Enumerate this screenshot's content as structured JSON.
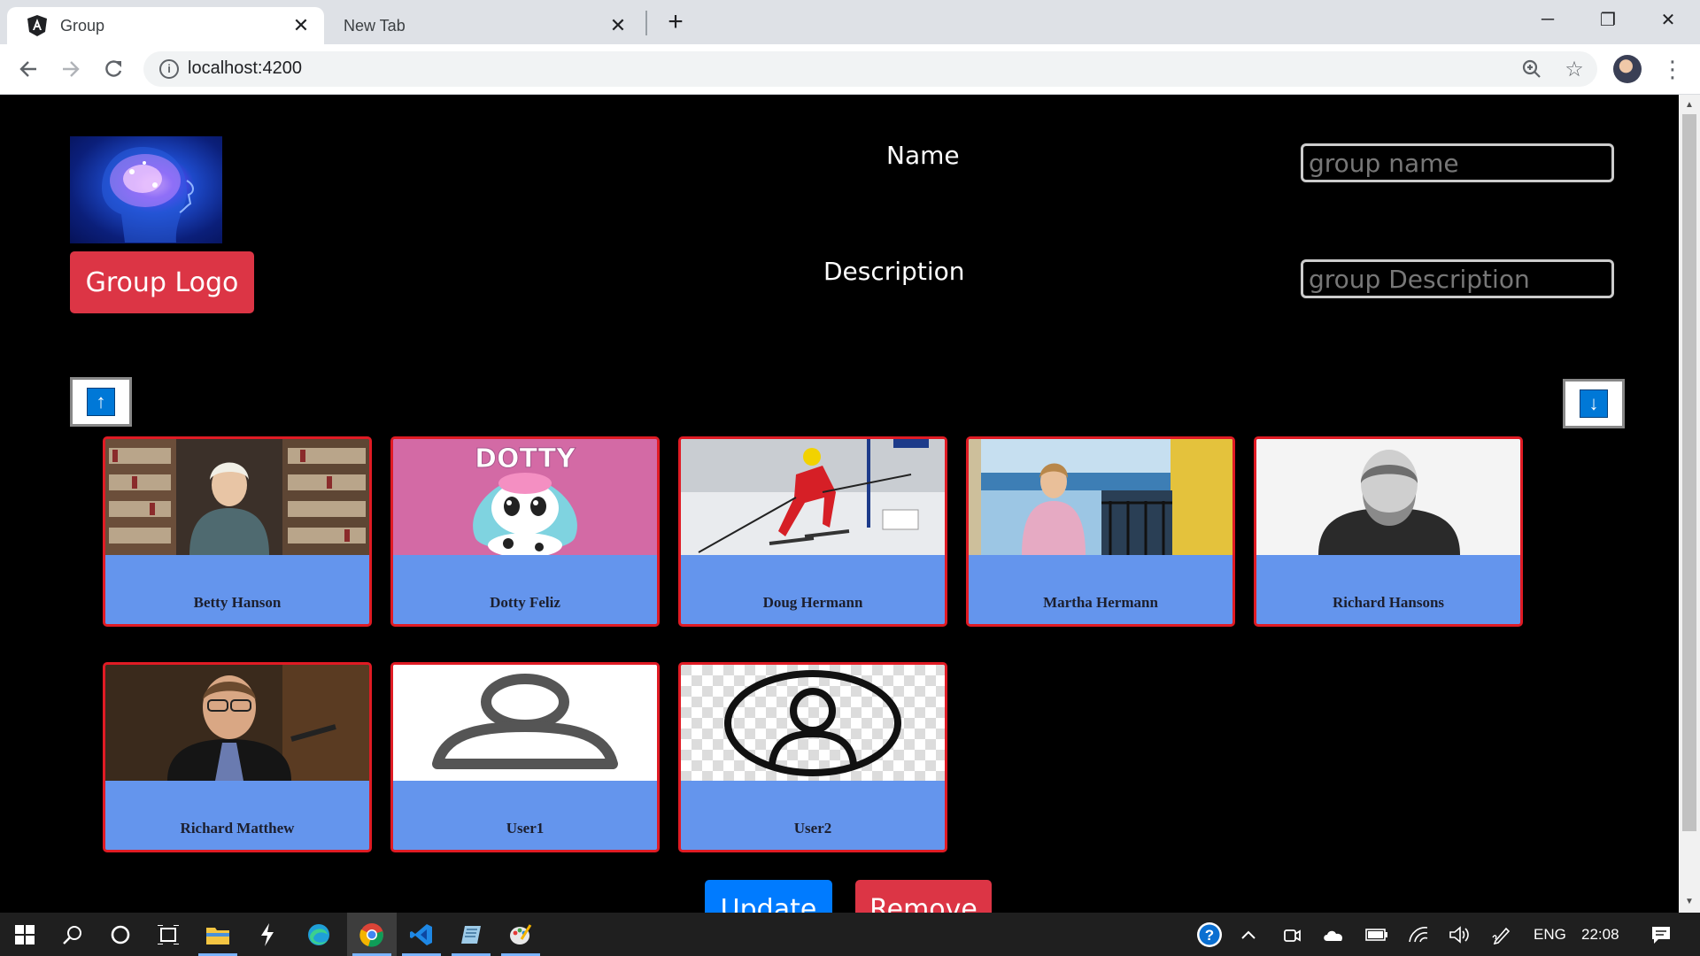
{
  "browser": {
    "tabs": [
      {
        "title": "Group",
        "active": true,
        "favicon": "angular-icon"
      },
      {
        "title": "New Tab",
        "active": false
      }
    ],
    "new_tab_label": "+",
    "url": "localhost:4200",
    "window_controls": {
      "minimize": "─",
      "restore": "❐",
      "close": "✕"
    }
  },
  "page": {
    "logo_button_label": "Group Logo",
    "name_label": "Name",
    "name_placeholder": "group name",
    "description_label": "Description",
    "description_placeholder": "group Description",
    "scroll_up_icon": "↑",
    "scroll_down_icon": "↓",
    "members": [
      {
        "name": "Betty Hanson",
        "photo": "library"
      },
      {
        "name": "Dotty Feliz",
        "photo": "dotty"
      },
      {
        "name": "Doug Hermann",
        "photo": "skier"
      },
      {
        "name": "Martha Hermann",
        "photo": "balcony"
      },
      {
        "name": "Richard Hansons",
        "photo": "portrait"
      },
      {
        "name": "Richard Matthew",
        "photo": "speaker"
      },
      {
        "name": "User1",
        "photo": "user-outline"
      },
      {
        "name": "User2",
        "photo": "user-circle"
      }
    ],
    "update_label": "Update",
    "remove_label": "Remove"
  },
  "taskbar": {
    "language": "ENG",
    "time": "22:08"
  },
  "colors": {
    "card_border": "#e01b24",
    "card_caption_bg": "#6495ed",
    "danger": "#dc3545",
    "primary": "#007bff"
  }
}
